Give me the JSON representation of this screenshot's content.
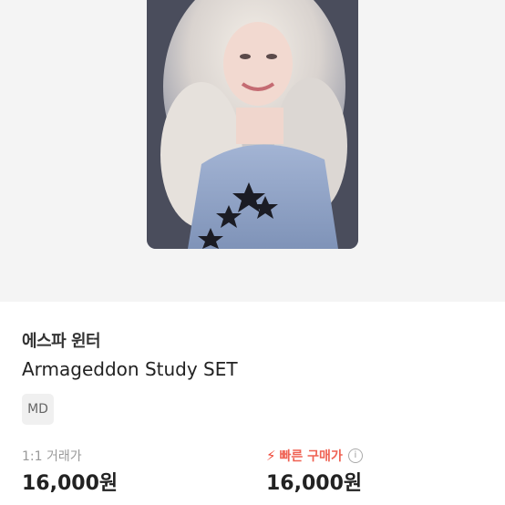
{
  "product": {
    "artist": "에스파 윈터",
    "name": "Armageddon Study SET",
    "tag": "MD"
  },
  "pricing": {
    "trade_label": "1:1 거래가",
    "trade_price": "16,000원",
    "quick_label": "빠른 구매가",
    "quick_price": "16,000원",
    "quick_icon": "lightning-icon",
    "info_icon": "info-icon",
    "accent_color": "#ef4636"
  }
}
